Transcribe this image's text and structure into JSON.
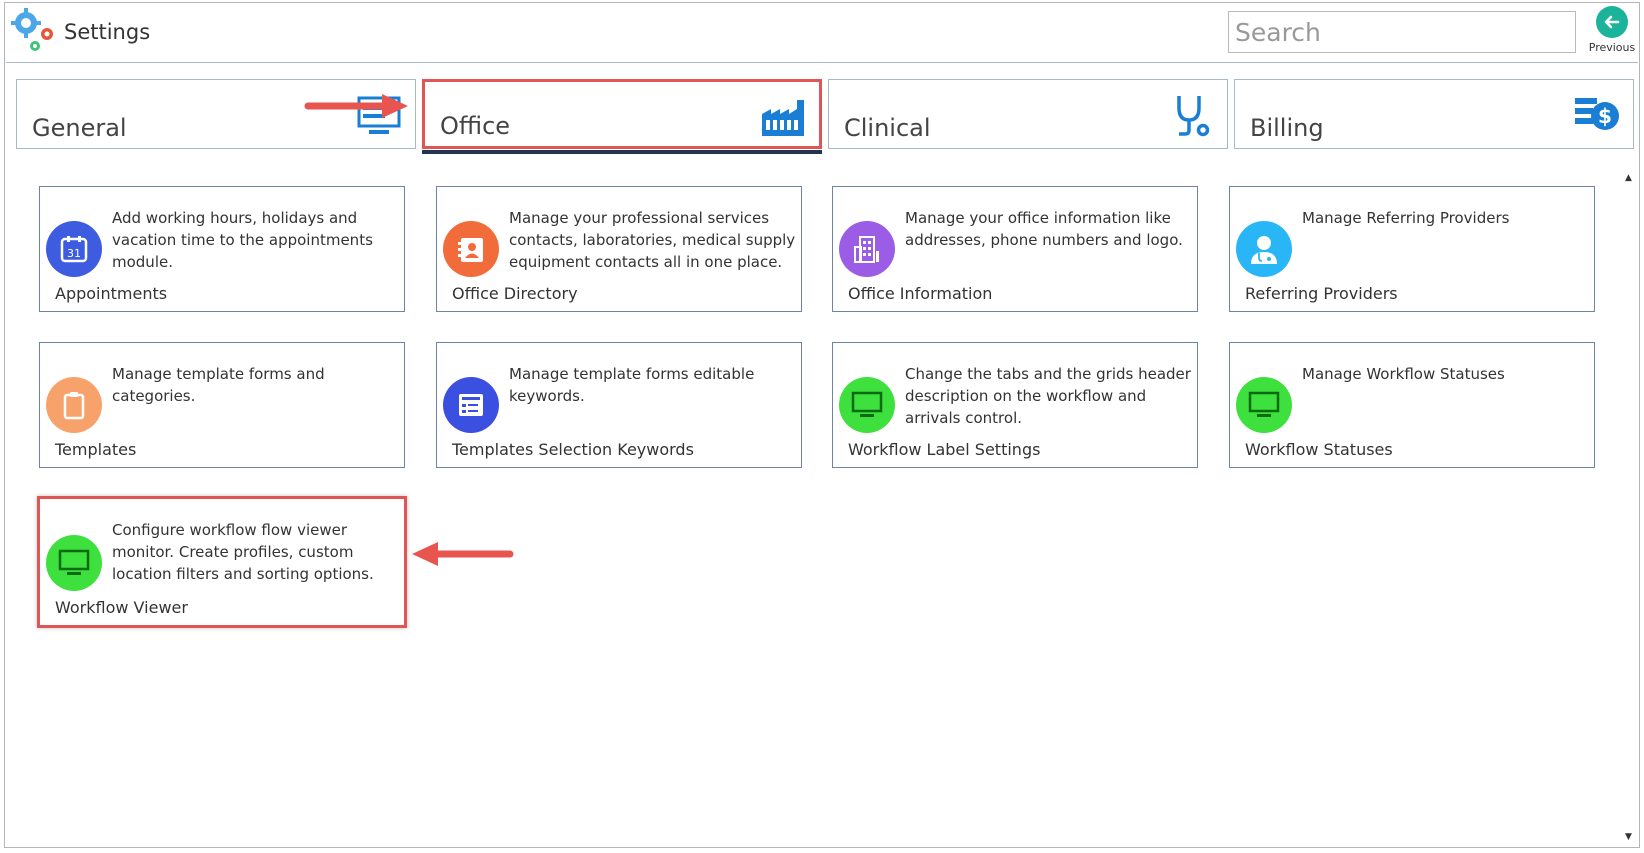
{
  "window": {
    "title": "Settings",
    "search_placeholder": "Search",
    "previous_label": "Previous"
  },
  "tabs": [
    {
      "label": "General",
      "icon": "monitor-settings-icon"
    },
    {
      "label": "Office",
      "icon": "factory-icon",
      "active": true
    },
    {
      "label": "Clinical",
      "icon": "stethoscope-icon"
    },
    {
      "label": "Billing",
      "icon": "billing-dollar-icon"
    }
  ],
  "cards": [
    {
      "title": "Appointments",
      "description": "Add working hours, holidays and vacation time to the appointments module.",
      "icon": "calendar-icon",
      "icon_color": "#3d5ce0",
      "icon_text": "31"
    },
    {
      "title": "Office Directory",
      "description": "Manage your professional services contacts, laboratories, medical supply equipment contacts all in one place.",
      "icon": "contact-book-icon",
      "icon_color": "#f26b3a"
    },
    {
      "title": "Office Information",
      "description": "Manage your office information like addresses, phone numbers and logo.",
      "icon": "building-icon",
      "icon_color": "#9b5de5"
    },
    {
      "title": "Referring Providers",
      "description": "Manage Referring Providers",
      "icon": "doctor-icon",
      "icon_color": "#29b6f6"
    },
    {
      "title": "Templates",
      "description": "Manage template forms and categories.",
      "icon": "clipboard-icon",
      "icon_color": "#f7a26b"
    },
    {
      "title": "Templates Selection Keywords",
      "description": "Manage template forms editable keywords.",
      "icon": "form-checklist-icon",
      "icon_color": "#3b4fe0"
    },
    {
      "title": "Workflow Label Settings",
      "description": "Change the tabs and the grids header description on the workflow and arrivals control.",
      "icon": "monitor-icon",
      "icon_color": "#3ee03e"
    },
    {
      "title": "Workflow Statuses",
      "description": "Manage Workflow Statuses",
      "icon": "monitor-icon",
      "icon_color": "#3ee03e"
    },
    {
      "title": "Workflow Viewer",
      "description": "Configure workflow flow viewer monitor. Create profiles, custom location filters and sorting options.",
      "icon": "monitor-icon",
      "icon_color": "#3ee03e"
    }
  ],
  "colors": {
    "highlight": "#e05656",
    "tab_underline": "#23344d",
    "card_border": "#6d84a6",
    "tab_icon_blue": "#1a7fd4"
  }
}
